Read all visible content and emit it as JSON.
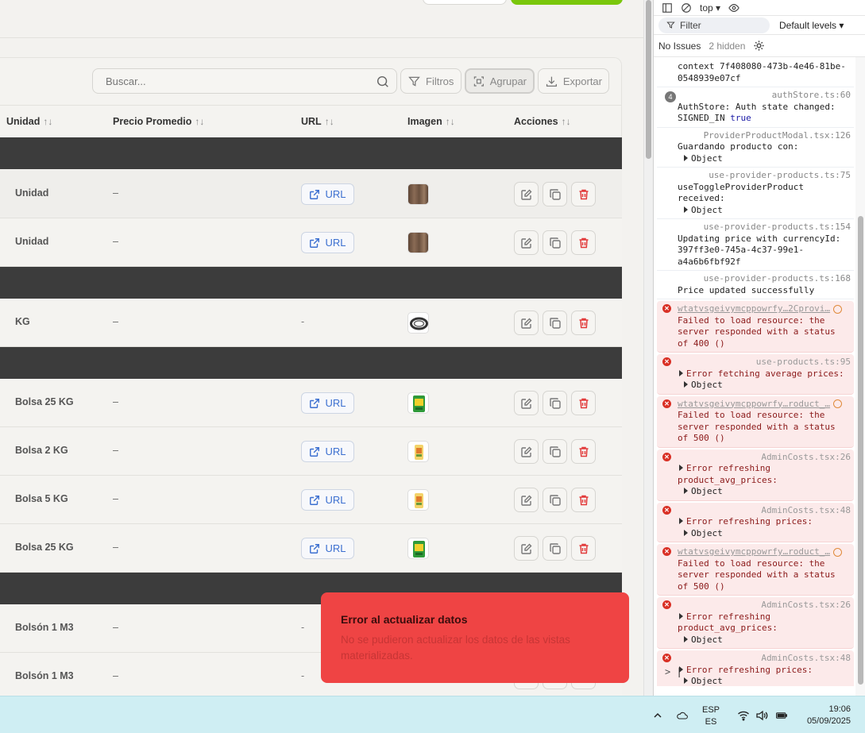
{
  "toolbar": {
    "search_placeholder": "Buscar...",
    "filters_label": "Filtros",
    "group_label": "Agrupar",
    "export_label": "Exportar"
  },
  "table": {
    "headers": {
      "unit": "Unidad",
      "avg_price": "Precio Promedio",
      "url": "URL",
      "image": "Imagen",
      "actions": "Acciones",
      "sort_symbol": "↑↓"
    },
    "url_label": "URL",
    "rows": [
      {
        "unit": "Unidad",
        "price": "–",
        "url": true,
        "thumb": "wood"
      },
      {
        "unit": "Unidad",
        "price": "–",
        "url": true,
        "thumb": "wood"
      },
      {
        "unit": "KG",
        "price": "–",
        "url": false,
        "url_text": "-",
        "thumb": "coil"
      },
      {
        "unit": "Bolsa 25 KG",
        "price": "–",
        "url": true,
        "thumb": "bag-green"
      },
      {
        "unit": "Bolsa 2 KG",
        "price": "–",
        "url": true,
        "thumb": "bag-yellow"
      },
      {
        "unit": "Bolsa 5 KG",
        "price": "–",
        "url": true,
        "thumb": "bag-yellow"
      },
      {
        "unit": "Bolsa 25 KG",
        "price": "–",
        "url": true,
        "thumb": "bag-green"
      },
      {
        "unit": "Bolsón 1 M3",
        "price": "–",
        "url": false,
        "url_text": "-",
        "thumb": "none"
      },
      {
        "unit": "Bolsón 1 M3",
        "price": "–",
        "url": false,
        "url_text": "-",
        "thumb": "none"
      }
    ]
  },
  "toast": {
    "title": "Error al actualizar datos",
    "body": "No se pudieron actualizar los datos de las vistas materializadas."
  },
  "devtools": {
    "context_selector": "top ▾",
    "filter_label": "Filter",
    "levels_label": "Default levels ▾",
    "issues_label": "No Issues",
    "hidden_label": "2 hidden",
    "messages": [
      {
        "type": "log",
        "src": "",
        "text": "context 7f408080-473b-4e46-81be-0548939e07cf"
      },
      {
        "type": "log",
        "badge": "4",
        "src": "authStore.ts:60",
        "text": "AuthStore: Auth state changed: SIGNED_IN",
        "tail": "true"
      },
      {
        "type": "log",
        "src": "ProviderProductModal.tsx:126",
        "text": "Guardando producto con:",
        "obj": "Object"
      },
      {
        "type": "log",
        "src": "use-provider-products.ts:75",
        "text": "useToggleProviderProduct received:",
        "obj": "Object"
      },
      {
        "type": "log",
        "src": "use-provider-products.ts:154",
        "text": "Updating price with currencyId: 397ff3e0-745a-4c37-99e1-a4a6b6fbf92f"
      },
      {
        "type": "log",
        "src": "use-provider-products.ts:168",
        "text": "Price updated successfully"
      },
      {
        "type": "err",
        "link": "wtatvsgeivymcppowrfy…2Cprovi…",
        "text": "Failed to load resource: the server responded with a status of 400 ()"
      },
      {
        "type": "err",
        "src": "use-products.ts:95",
        "text": "Error fetching average prices:",
        "obj": "Object"
      },
      {
        "type": "err",
        "link": "wtatvsgeivymcppowrfy…roduct_…",
        "text": "Failed to load resource: the server responded with a status of 500 ()"
      },
      {
        "type": "err",
        "src": "AdminCosts.tsx:26",
        "text": "Error refreshing product_avg_prices:",
        "obj": "Object"
      },
      {
        "type": "err",
        "src": "AdminCosts.tsx:48",
        "text": "Error refreshing prices:",
        "obj": "Object"
      },
      {
        "type": "err",
        "link": "wtatvsgeivymcppowrfy…roduct_…",
        "text": "Failed to load resource: the server responded with a status of 500 ()"
      },
      {
        "type": "err",
        "src": "AdminCosts.tsx:26",
        "text": "Error refreshing product_avg_prices:",
        "obj": "Object"
      },
      {
        "type": "err",
        "src": "AdminCosts.tsx:48",
        "text": "Error refreshing prices:",
        "obj": "Object"
      }
    ],
    "prompt": ">"
  },
  "taskbar": {
    "lang_top": "ESP",
    "lang_bottom": "ES",
    "time": "19:06",
    "date": "05/09/2025"
  },
  "colors": {
    "accent_green": "#7ac70c",
    "group_row": "#3c3c3c",
    "toast_bg": "#ef4444",
    "link_blue": "#3b6fd0",
    "delete_red": "#e23b3b"
  }
}
